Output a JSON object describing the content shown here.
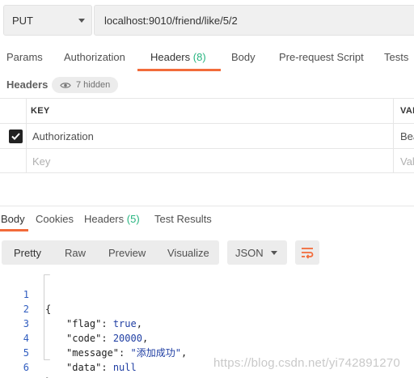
{
  "request": {
    "method": "PUT",
    "url": "localhost:9010/friend/like/5/2"
  },
  "request_tabs": [
    {
      "label": "Params",
      "count": ""
    },
    {
      "label": "Authorization",
      "count": ""
    },
    {
      "label": "Headers",
      "count": "(8)"
    },
    {
      "label": "Body",
      "count": ""
    },
    {
      "label": "Pre-request Script",
      "count": ""
    },
    {
      "label": "Tests",
      "count": ""
    }
  ],
  "headers_section": {
    "title": "Headers",
    "hidden": "7 hidden"
  },
  "headers_table": {
    "columns": [
      "KEY",
      "VAL"
    ],
    "rows": [
      {
        "key": "Authorization",
        "value": "Bea",
        "checked": true
      }
    ],
    "placeholder_key": "Key",
    "placeholder_value": "Val"
  },
  "response_tabs": [
    {
      "label": "Body",
      "count": ""
    },
    {
      "label": "Cookies",
      "count": ""
    },
    {
      "label": "Headers",
      "count": "(5)"
    },
    {
      "label": "Test Results",
      "count": ""
    }
  ],
  "format": {
    "buttons": [
      "Pretty",
      "Raw",
      "Preview",
      "Visualize"
    ],
    "language": "JSON"
  },
  "code": {
    "line_numbers": [
      "1",
      "2",
      "3",
      "4",
      "5",
      "6"
    ],
    "lines": {
      "open": "{",
      "flag_key": "\"flag\"",
      "flag_val": "true",
      "code_key": "\"code\"",
      "code_val": "20000",
      "message_key": "\"message\"",
      "message_val": "\"添加成功\"",
      "data_key": "\"data\"",
      "data_val": "null",
      "close": "}"
    }
  },
  "watermark": "https://blog.csdn.net/yi742891270",
  "colors": {
    "accent": "#f26b3a",
    "count_green": "#26b47f",
    "code_value": "#1f3ea3"
  }
}
